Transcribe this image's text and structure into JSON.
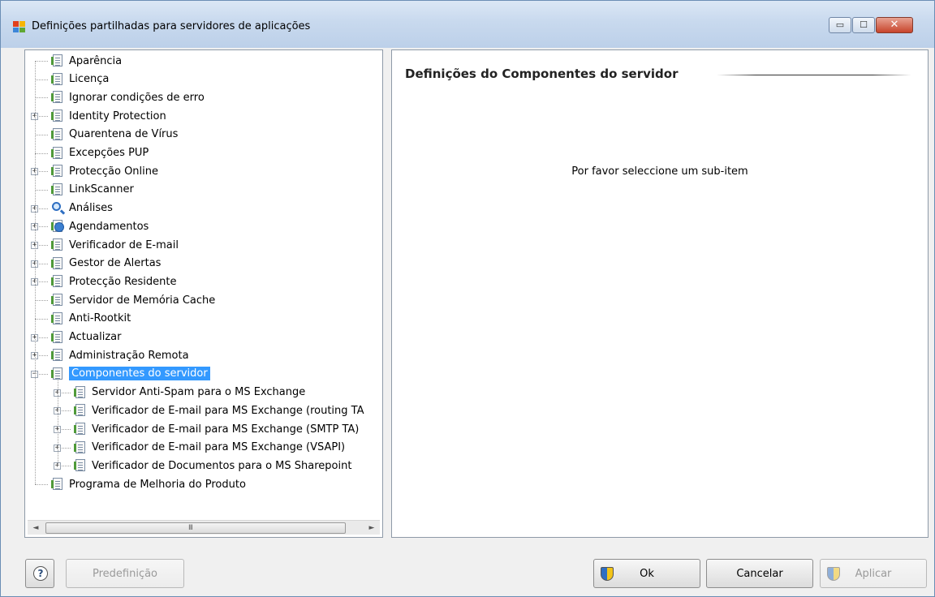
{
  "window": {
    "title": "Definições partilhadas para servidores de aplicações",
    "controls": {
      "minimize": "▭",
      "maximize": "☐",
      "close": "✕"
    }
  },
  "tree": {
    "items": [
      {
        "label": "Aparência",
        "icon": "doc-icon",
        "expandable": false
      },
      {
        "label": "Licença",
        "icon": "doc-icon",
        "expandable": false
      },
      {
        "label": "Ignorar condições de erro",
        "icon": "doc-icon",
        "expandable": false
      },
      {
        "label": "Identity Protection",
        "icon": "doc-icon",
        "expandable": true
      },
      {
        "label": "Quarentena de Vírus",
        "icon": "doc-icon",
        "expandable": false
      },
      {
        "label": "Excepções PUP",
        "icon": "doc-icon",
        "expandable": false
      },
      {
        "label": "Protecção Online",
        "icon": "doc-icon",
        "expandable": true
      },
      {
        "label": "LinkScanner",
        "icon": "doc-icon",
        "expandable": false
      },
      {
        "label": "Análises",
        "icon": "search-icon",
        "expandable": true
      },
      {
        "label": "Agendamentos",
        "icon": "schedule-icon",
        "expandable": true
      },
      {
        "label": "Verificador de E-mail",
        "icon": "doc-icon",
        "expandable": true
      },
      {
        "label": "Gestor de Alertas",
        "icon": "doc-icon",
        "expandable": true
      },
      {
        "label": "Protecção Residente",
        "icon": "doc-icon",
        "expandable": true
      },
      {
        "label": "Servidor de Memória Cache",
        "icon": "doc-icon",
        "expandable": false
      },
      {
        "label": "Anti-Rootkit",
        "icon": "doc-icon",
        "expandable": false
      },
      {
        "label": "Actualizar",
        "icon": "doc-icon",
        "expandable": true
      },
      {
        "label": "Administração Remota",
        "icon": "doc-icon",
        "expandable": true
      },
      {
        "label": "Componentes do servidor",
        "icon": "doc-icon",
        "expandable": true,
        "expanded": true,
        "selected": true
      },
      {
        "label": "Servidor Anti-Spam para o MS Exchange",
        "icon": "doc-icon",
        "expandable": true,
        "child": true
      },
      {
        "label": "Verificador de E-mail para MS Exchange (routing TA",
        "icon": "doc-icon",
        "expandable": true,
        "child": true
      },
      {
        "label": "Verificador de E-mail para MS Exchange (SMTP TA)",
        "icon": "doc-icon",
        "expandable": true,
        "child": true
      },
      {
        "label": "Verificador de E-mail para MS Exchange (VSAPI)",
        "icon": "doc-icon",
        "expandable": true,
        "child": true
      },
      {
        "label": "Verificador de Documentos para o MS Sharepoint",
        "icon": "doc-icon",
        "expandable": true,
        "child": true
      },
      {
        "label": "Programa de Melhoria do Produto",
        "icon": "doc-icon",
        "expandable": false
      }
    ],
    "scrollbar": {
      "left_arrow": "◄",
      "right_arrow": "►",
      "grip": "III"
    }
  },
  "content": {
    "title": "Definições do Componentes do servidor",
    "hint": "Por favor seleccione um sub-item"
  },
  "buttons": {
    "help": "?",
    "default": "Predefinição",
    "ok": "Ok",
    "cancel": "Cancelar",
    "apply": "Aplicar"
  }
}
